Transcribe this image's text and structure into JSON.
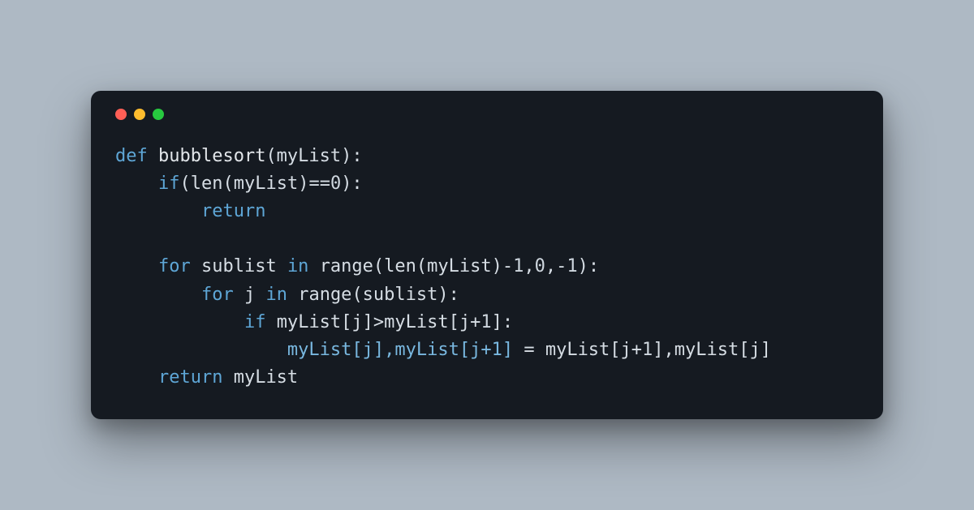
{
  "colors": {
    "background": "#aeb9c4",
    "window_bg": "#151a21",
    "text": "#d6dde4",
    "keyword": "#5ea6d6",
    "assigned": "#79b8e0",
    "traffic_red": "#ff5f56",
    "traffic_yellow": "#ffbd2e",
    "traffic_green": "#27c93f"
  },
  "code": {
    "l1": {
      "def": "def ",
      "name": "bubblesort",
      "open": "(myList):"
    },
    "l2": {
      "indent": "    ",
      "if": "if",
      "rest": "(",
      "len": "len",
      "rest2": "(myList)==",
      "zero": "0",
      "rest3": "):"
    },
    "l3": {
      "indent": "        ",
      "ret": "return"
    },
    "l4": {
      "indent": ""
    },
    "l5": {
      "indent": "    ",
      "for": "for ",
      "var": "sublist ",
      "in": "in ",
      "range": "range",
      "rest": "(",
      "len": "len",
      "rest2": "(myList)-",
      "one": "1",
      "rest3": ",",
      "zero": "0",
      "rest4": ",-",
      "one2": "1",
      "rest5": "):"
    },
    "l6": {
      "indent": "        ",
      "for": "for ",
      "var": "j ",
      "in": "in ",
      "range": "range",
      "rest": "(sublist):"
    },
    "l7": {
      "indent": "            ",
      "if": "if ",
      "rest": "myList[j]>myList[j+",
      "one": "1",
      "rest2": "]:"
    },
    "l8": {
      "indent": "                ",
      "lhs": "myList[j],myList[j+1]",
      "eq": " = ",
      "rhs": "myList[j+",
      "one": "1",
      "rhs2": "],myList[j]"
    },
    "l9": {
      "indent": "    ",
      "ret": "return ",
      "val": "myList"
    }
  }
}
